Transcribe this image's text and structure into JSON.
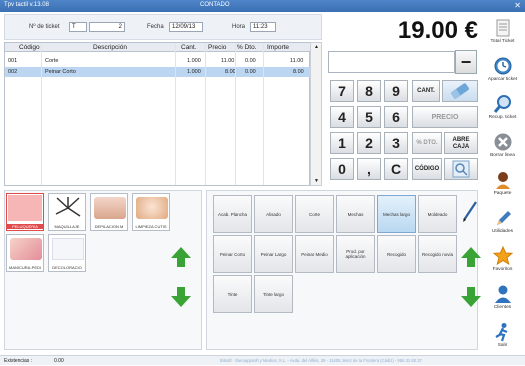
{
  "window": {
    "app_title": "Tpv tactil v.13.08",
    "mode": "CONTADO"
  },
  "header": {
    "ticket_label": "Nº de ticket",
    "ticket_series": "T",
    "ticket_number": "2",
    "date_label": "Fecha",
    "date_value": "12/09/13",
    "time_label": "Hora",
    "time_value": "11:23"
  },
  "table": {
    "columns": [
      "Código",
      "Descripción",
      "Cant.",
      "Precio",
      "% Dto.",
      "Importe"
    ],
    "rows": [
      {
        "code": "001",
        "desc": "Corte",
        "qty": "1.000",
        "price": "11.00",
        "disc": "0.00",
        "amount": "11.00"
      },
      {
        "code": "002",
        "desc": "Peinar Corto",
        "qty": "1.000",
        "price": "8.00",
        "disc": "0.00",
        "amount": "8.00"
      }
    ]
  },
  "total": "19.00 €",
  "keypad": {
    "digits": [
      "7",
      "8",
      "9",
      "4",
      "5",
      "6",
      "1",
      "2",
      "3",
      "0",
      ",",
      "C"
    ],
    "cant": "CANT.",
    "precio": "PRECIO",
    "dto": "% DTO.",
    "abre_caja_1": "ABRE",
    "abre_caja_2": "CAJA",
    "codigo": "CÓDIGO"
  },
  "sidebar": [
    {
      "label": "Total Ticket",
      "icon": "receipt-icon"
    },
    {
      "label": "Aparcar ticket",
      "icon": "clock-icon"
    },
    {
      "label": "Recup. ticket",
      "icon": "search-icon"
    },
    {
      "label": "Borrar linea",
      "icon": "delete-icon"
    },
    {
      "label": "Paquete",
      "icon": "person-icon"
    },
    {
      "label": "Utilidades",
      "icon": "pencil-icon"
    },
    {
      "label": "Favoritos",
      "icon": "star-icon"
    },
    {
      "label": "Clientes",
      "icon": "clients-icon"
    },
    {
      "label": "Salir",
      "icon": "exit-icon"
    }
  ],
  "categories": [
    "PELUQUERIA",
    "MAQUILLAJE",
    "DEPILACION M",
    "LIMPIEZA CUTIS",
    "MANICURA-PEDI",
    "DECOLORACIO"
  ],
  "services": [
    "Acab. Plancha",
    "Alisado",
    "Corte",
    "Mechas",
    "Mechas largo",
    "Moldeado",
    "Peinar Corto",
    "Peinar Largo",
    "Peinar Medio",
    "Prod. por aplicación",
    "Recogido",
    "Recogido novia",
    "Tinte",
    "Tinte largo"
  ],
  "selected_service": "Mechas largo",
  "status": {
    "stock_label": "Existencias :",
    "stock_value": "0.00",
    "company": "Bitsoft · Iberoappsoft y Medios, S.L. - Avda. del Alféis, 29 - 11405 Jerez de la Frontera (Cádiz) - 956 31 60 37"
  },
  "colors": {
    "accent": "#3a6fb2",
    "selected_row": "#bcd6f1",
    "arrow_green": "#3aa335"
  }
}
